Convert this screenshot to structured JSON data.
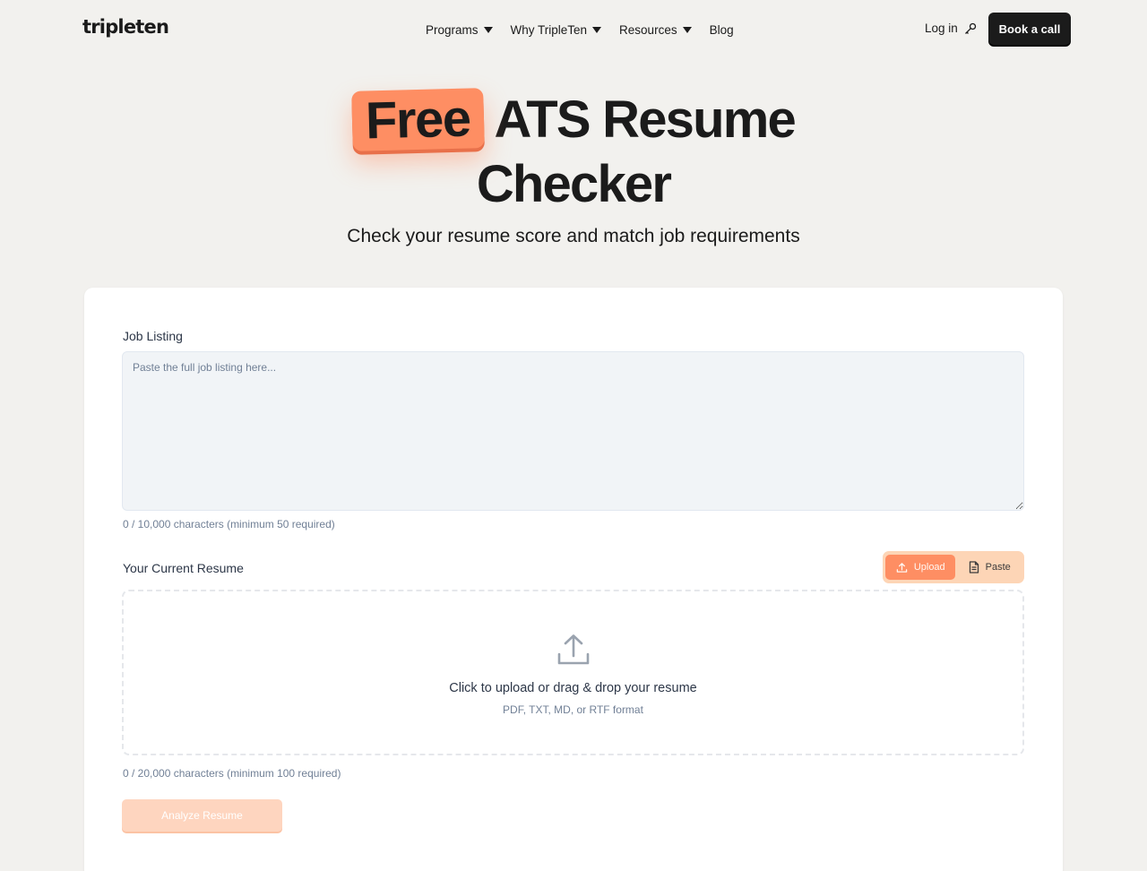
{
  "header": {
    "logo": "tripleten",
    "nav": [
      {
        "label": "Programs",
        "has_dropdown": true
      },
      {
        "label": "Why TripleTen",
        "has_dropdown": true
      },
      {
        "label": "Resources",
        "has_dropdown": true
      },
      {
        "label": "Blog",
        "has_dropdown": false
      }
    ],
    "login_label": "Log in",
    "login_icon": "key-icon",
    "cta_label": "Book a call"
  },
  "hero": {
    "badge_word": "Free",
    "title_rest": "ATS Resume",
    "title_line2": "Checker",
    "subtitle": "Check your resume score and match job requirements",
    "badge_color": "#fe8e63"
  },
  "form": {
    "job_listing": {
      "label": "Job Listing",
      "placeholder": "Paste the full job listing here...",
      "value": "",
      "counter": "0 / 10,000 characters (minimum 50 required)"
    },
    "resume": {
      "label": "Your Current Resume",
      "mode_toggle": {
        "upload_label": "Upload",
        "paste_label": "Paste",
        "selected": "Upload",
        "upload_icon": "upload-icon",
        "paste_icon": "document-icon"
      },
      "dropzone": {
        "icon": "upload-tray-icon",
        "title": "Click to upload or drag & drop your resume",
        "subtitle": "PDF, TXT, MD, or RTF format"
      },
      "counter": "0 / 20,000 characters (minimum 100 required)"
    },
    "submit_label": "Analyze Resume",
    "submit_disabled": true
  },
  "colors": {
    "accent": "#fe8e63",
    "accent_light": "#fdd5b6",
    "background": "#f2f1ee",
    "dark": "#1b1b1b"
  }
}
